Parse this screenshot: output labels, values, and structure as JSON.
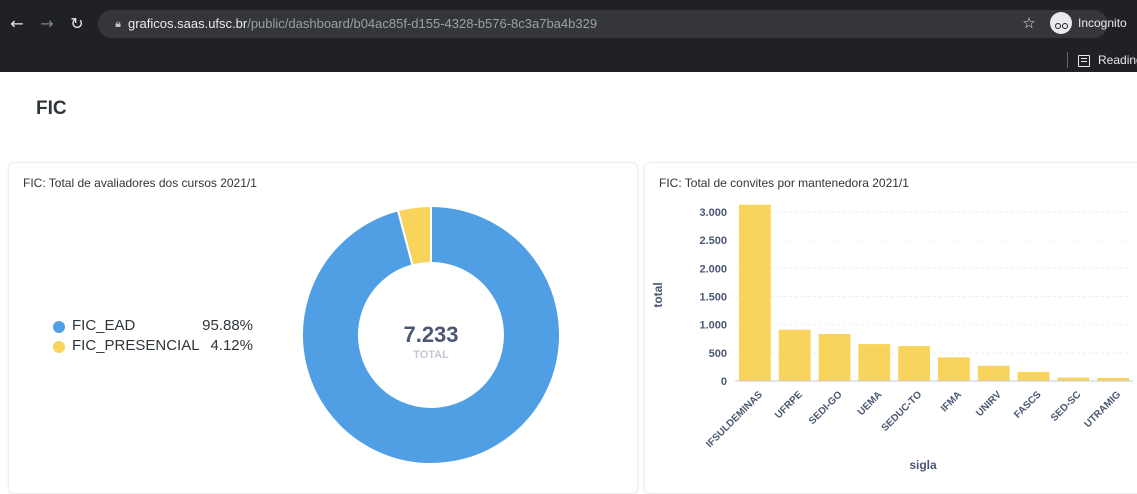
{
  "browser": {
    "url_host": "graficos.saas.ufsc.br",
    "url_path": "/public/dashboard/b04ac85f-d155-4328-b576-8c3a7ba4b329",
    "incognito_label": "Incognito",
    "reading_list_label": "Reading"
  },
  "dashboard": {
    "title": "FIC"
  },
  "charts": {
    "donut": {
      "title": "FIC: Total de avaliadores dos cursos 2021/1",
      "total_value": "7.233",
      "total_label": "TOTAL",
      "legend": [
        {
          "name": "FIC_EAD",
          "pct": "95.88%",
          "color": "#509ee3"
        },
        {
          "name": "FIC_PRESENCIAL",
          "pct": "4.12%",
          "color": "#f9d45c"
        }
      ]
    },
    "bar": {
      "title": "FIC: Total de convites por mantenedora 2021/1",
      "xlabel": "sigla",
      "ylabel": "total",
      "color": "#f9d45c"
    }
  },
  "chart_data": [
    {
      "type": "pie",
      "title": "FIC: Total de avaliadores dos cursos 2021/1",
      "categories": [
        "FIC_EAD",
        "FIC_PRESENCIAL"
      ],
      "values": [
        95.88,
        4.12
      ],
      "total": 7233,
      "colors": [
        "#509ee3",
        "#f9d45c"
      ],
      "legend": "left"
    },
    {
      "type": "bar",
      "title": "FIC: Total de convites por mantenedora 2021/1",
      "categories": [
        "IFSULDEMINAS",
        "UFRPE",
        "SEDI-GO",
        "UEMA",
        "SEDUC-TO",
        "IFMA",
        "UNIRV",
        "FASCS",
        "SED-SC",
        "UTRAMIG"
      ],
      "values": [
        3130,
        910,
        835,
        655,
        620,
        420,
        270,
        160,
        60,
        55
      ],
      "xlabel": "sigla",
      "ylabel": "total",
      "ylim": [
        0,
        3000
      ],
      "yticks": [
        "0",
        "500",
        "1.000",
        "1.500",
        "2.000",
        "2.500",
        "3.000"
      ],
      "grid": true
    }
  ]
}
